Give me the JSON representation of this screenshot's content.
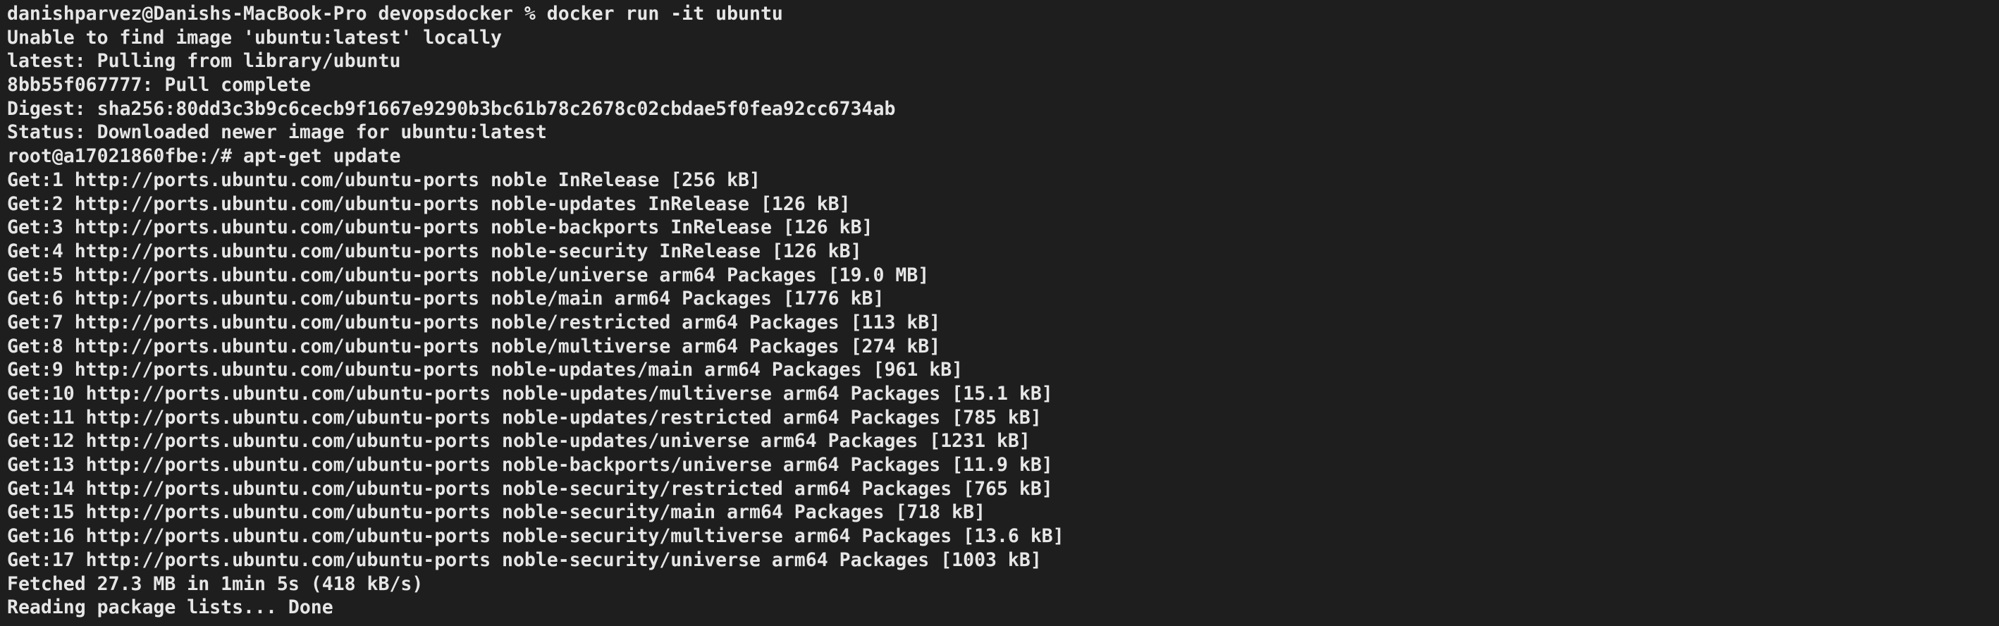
{
  "terminal": {
    "lines": [
      "danishparvez@Danishs-MacBook-Pro devopsdocker % docker run -it ubuntu",
      "Unable to find image 'ubuntu:latest' locally",
      "latest: Pulling from library/ubuntu",
      "8bb55f067777: Pull complete",
      "Digest: sha256:80dd3c3b9c6cecb9f1667e9290b3bc61b78c2678c02cbdae5f0fea92cc6734ab",
      "Status: Downloaded newer image for ubuntu:latest",
      "root@a17021860fbe:/# apt-get update",
      "Get:1 http://ports.ubuntu.com/ubuntu-ports noble InRelease [256 kB]",
      "Get:2 http://ports.ubuntu.com/ubuntu-ports noble-updates InRelease [126 kB]",
      "Get:3 http://ports.ubuntu.com/ubuntu-ports noble-backports InRelease [126 kB]",
      "Get:4 http://ports.ubuntu.com/ubuntu-ports noble-security InRelease [126 kB]",
      "Get:5 http://ports.ubuntu.com/ubuntu-ports noble/universe arm64 Packages [19.0 MB]",
      "Get:6 http://ports.ubuntu.com/ubuntu-ports noble/main arm64 Packages [1776 kB]",
      "Get:7 http://ports.ubuntu.com/ubuntu-ports noble/restricted arm64 Packages [113 kB]",
      "Get:8 http://ports.ubuntu.com/ubuntu-ports noble/multiverse arm64 Packages [274 kB]",
      "Get:9 http://ports.ubuntu.com/ubuntu-ports noble-updates/main arm64 Packages [961 kB]",
      "Get:10 http://ports.ubuntu.com/ubuntu-ports noble-updates/multiverse arm64 Packages [15.1 kB]",
      "Get:11 http://ports.ubuntu.com/ubuntu-ports noble-updates/restricted arm64 Packages [785 kB]",
      "Get:12 http://ports.ubuntu.com/ubuntu-ports noble-updates/universe arm64 Packages [1231 kB]",
      "Get:13 http://ports.ubuntu.com/ubuntu-ports noble-backports/universe arm64 Packages [11.9 kB]",
      "Get:14 http://ports.ubuntu.com/ubuntu-ports noble-security/restricted arm64 Packages [765 kB]",
      "Get:15 http://ports.ubuntu.com/ubuntu-ports noble-security/main arm64 Packages [718 kB]",
      "Get:16 http://ports.ubuntu.com/ubuntu-ports noble-security/multiverse arm64 Packages [13.6 kB]",
      "Get:17 http://ports.ubuntu.com/ubuntu-ports noble-security/universe arm64 Packages [1003 kB]",
      "Fetched 27.3 MB in 1min 5s (418 kB/s)",
      "Reading package lists... Done"
    ]
  },
  "colors": {
    "background": "#1e1e1e",
    "text": "#e6e6e6"
  }
}
